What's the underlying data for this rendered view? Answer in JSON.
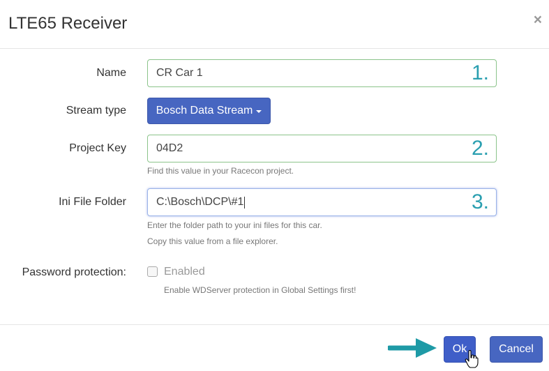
{
  "dialog": {
    "title": "LTE65 Receiver",
    "close_symbol": "×"
  },
  "form": {
    "name": {
      "label": "Name",
      "value": "CR Car 1",
      "step": "1."
    },
    "stream_type": {
      "label": "Stream type",
      "value": "Bosch Data Stream"
    },
    "project_key": {
      "label": "Project Key",
      "value": "04D2",
      "step": "2.",
      "help": "Find this value in your Racecon project."
    },
    "ini_folder": {
      "label": "Ini File Folder",
      "value": "C:\\Bosch\\DCP\\#1",
      "step": "3.",
      "help1": "Enter the folder path to your ini files for this car.",
      "help2": "Copy this value from a file explorer."
    },
    "password": {
      "label": "Password protection:",
      "checkbox_label": "Enabled",
      "checked": false,
      "help": "Enable WDServer protection in Global Settings first!"
    }
  },
  "footer": {
    "ok_label": "Ok",
    "cancel_label": "Cancel"
  },
  "colors": {
    "primary": "#4766c1",
    "valid_border": "#8bc48a",
    "step_annotation": "#2a9fb0",
    "arrow": "#1e9aa6"
  },
  "icons": {
    "close": "close-icon",
    "dropdown": "caret-down-icon",
    "annotation": "arrow-right-icon",
    "pointer": "hand-cursor-icon"
  }
}
